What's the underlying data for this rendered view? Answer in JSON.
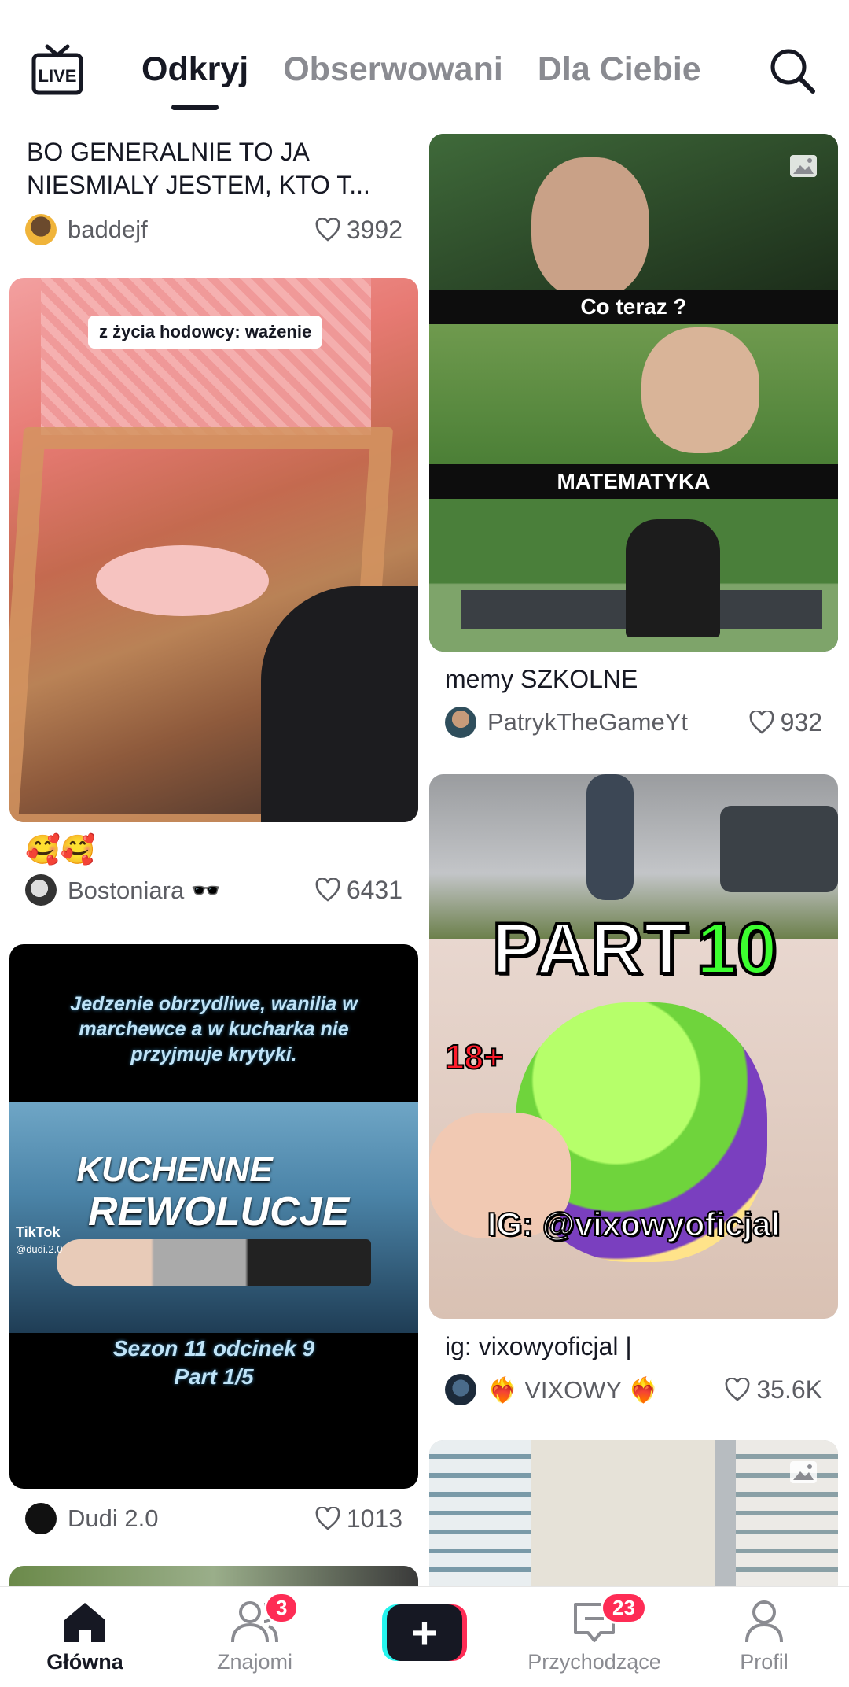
{
  "header": {
    "live_icon": "live-tv-icon",
    "tabs": [
      {
        "label": "Odkryj",
        "active": true
      },
      {
        "label": "Obserwowani",
        "active": false
      },
      {
        "label": "Dla Ciebie",
        "active": false
      }
    ],
    "search_icon": "search-icon"
  },
  "feed": {
    "left": [
      {
        "caption": "BO GENERALNIE TO JA NIESMIALY JESTEM, KTO T...",
        "author": "baddejf",
        "likes": "3992"
      },
      {
        "overlay": "z życia hodowcy: ważenie",
        "caption": "🥰🥰",
        "author": "Bostoniara 🕶️",
        "likes": "6431"
      },
      {
        "overlay_top": "Jedzenie obrzydliwe, wanilia w marchewce a w kucharka nie przyjmuje krytyki.",
        "overlay_title_1": "KUCHENNE",
        "overlay_title_2": "REWOLUCJE",
        "overlay_tiktok": "TikTok",
        "overlay_handle": "@dudi.2.0",
        "overlay_bottom_1": "Sezon 11 odcinek 9",
        "overlay_bottom_2": "Part 1/5",
        "author": "Dudi 2.0",
        "likes": "1013"
      }
    ],
    "right": [
      {
        "overlay_1": "Co teraz ?",
        "overlay_2": "MATEMATYKA",
        "caption": "memy SZKOLNE",
        "author": "PatrykTheGameYt",
        "likes": "932"
      },
      {
        "overlay_part": "PART",
        "overlay_num": "10",
        "overlay_18": "18+",
        "overlay_ig": "IG: @vixowyoficjal",
        "caption": "ig: vixowyoficjal |",
        "author": "❤️‍🔥 VIXOWY ❤️‍🔥",
        "likes": "35.6K"
      }
    ]
  },
  "bottom_nav": {
    "items": [
      {
        "label": "Główna",
        "icon": "home-icon",
        "active": true
      },
      {
        "label": "Znajomi",
        "icon": "friends-icon",
        "badge": "3"
      },
      {
        "label": "",
        "icon": "plus-icon"
      },
      {
        "label": "Przychodzące",
        "icon": "inbox-icon",
        "badge": "23"
      },
      {
        "label": "Profil",
        "icon": "profile-icon"
      }
    ]
  },
  "colors": {
    "accent": "#fe2c55",
    "cyan": "#25f4ee",
    "text": "#161823",
    "muted": "#8a8b91"
  }
}
